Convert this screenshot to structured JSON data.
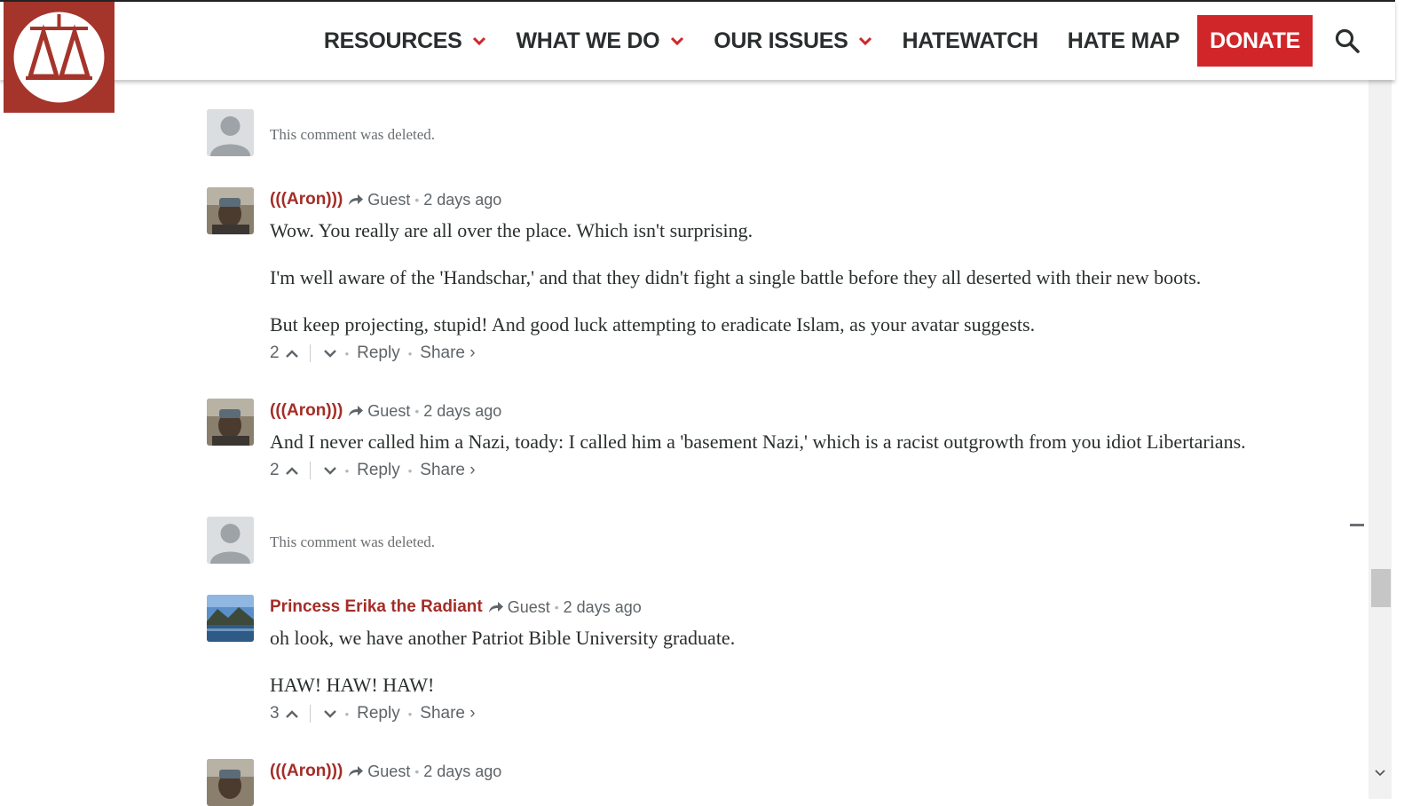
{
  "header": {
    "logo_icon": "scales-of-justice-icon",
    "nav": [
      {
        "label": "RESOURCES",
        "has_dropdown": true
      },
      {
        "label": "WHAT WE DO",
        "has_dropdown": true
      },
      {
        "label": "OUR ISSUES",
        "has_dropdown": true
      },
      {
        "label": "HATEWATCH",
        "has_dropdown": false
      },
      {
        "label": "HATE MAP",
        "has_dropdown": false
      }
    ],
    "donate_label": "DONATE",
    "search_icon": "search-icon",
    "colors": {
      "brand": "#a5342b",
      "donate": "#d0262a",
      "author": "#a42d27"
    }
  },
  "comments": [
    {
      "deleted": true,
      "text": "This comment was deleted."
    },
    {
      "deleted": false,
      "author": "(((Aron)))",
      "guest_label": "Guest",
      "time": "2 days ago",
      "paragraphs": [
        "Wow. You really are all over the place. Which isn't surprising.",
        "I'm well aware of the 'Handschar,' and that they didn't fight a single battle before they all deserted with their new boots.",
        "But keep projecting, stupid! And good luck attempting to eradicate Islam, as your avatar suggests."
      ],
      "votes": "2",
      "reply_label": "Reply",
      "share_label": "Share ›"
    },
    {
      "deleted": false,
      "author": "(((Aron)))",
      "guest_label": "Guest",
      "time": "2 days ago",
      "paragraphs": [
        "And I never called him a Nazi, toady: I called him a 'basement Nazi,' which is a racist outgrowth from you idiot Libertarians."
      ],
      "votes": "2",
      "reply_label": "Reply",
      "share_label": "Share ›"
    },
    {
      "deleted": true,
      "text": "This comment was deleted."
    },
    {
      "deleted": false,
      "author": "Princess Erika the Radiant",
      "guest_label": "Guest",
      "time": "2 days ago",
      "paragraphs": [
        "oh look, we have another Patriot Bible University graduate.",
        "HAW! HAW! HAW!"
      ],
      "votes": "3",
      "reply_label": "Reply",
      "share_label": "Share ›"
    },
    {
      "deleted": false,
      "author": "(((Aron)))",
      "guest_label": "Guest",
      "time": "2 days ago",
      "paragraphs": [],
      "votes": "",
      "reply_label": "",
      "share_label": ""
    }
  ]
}
